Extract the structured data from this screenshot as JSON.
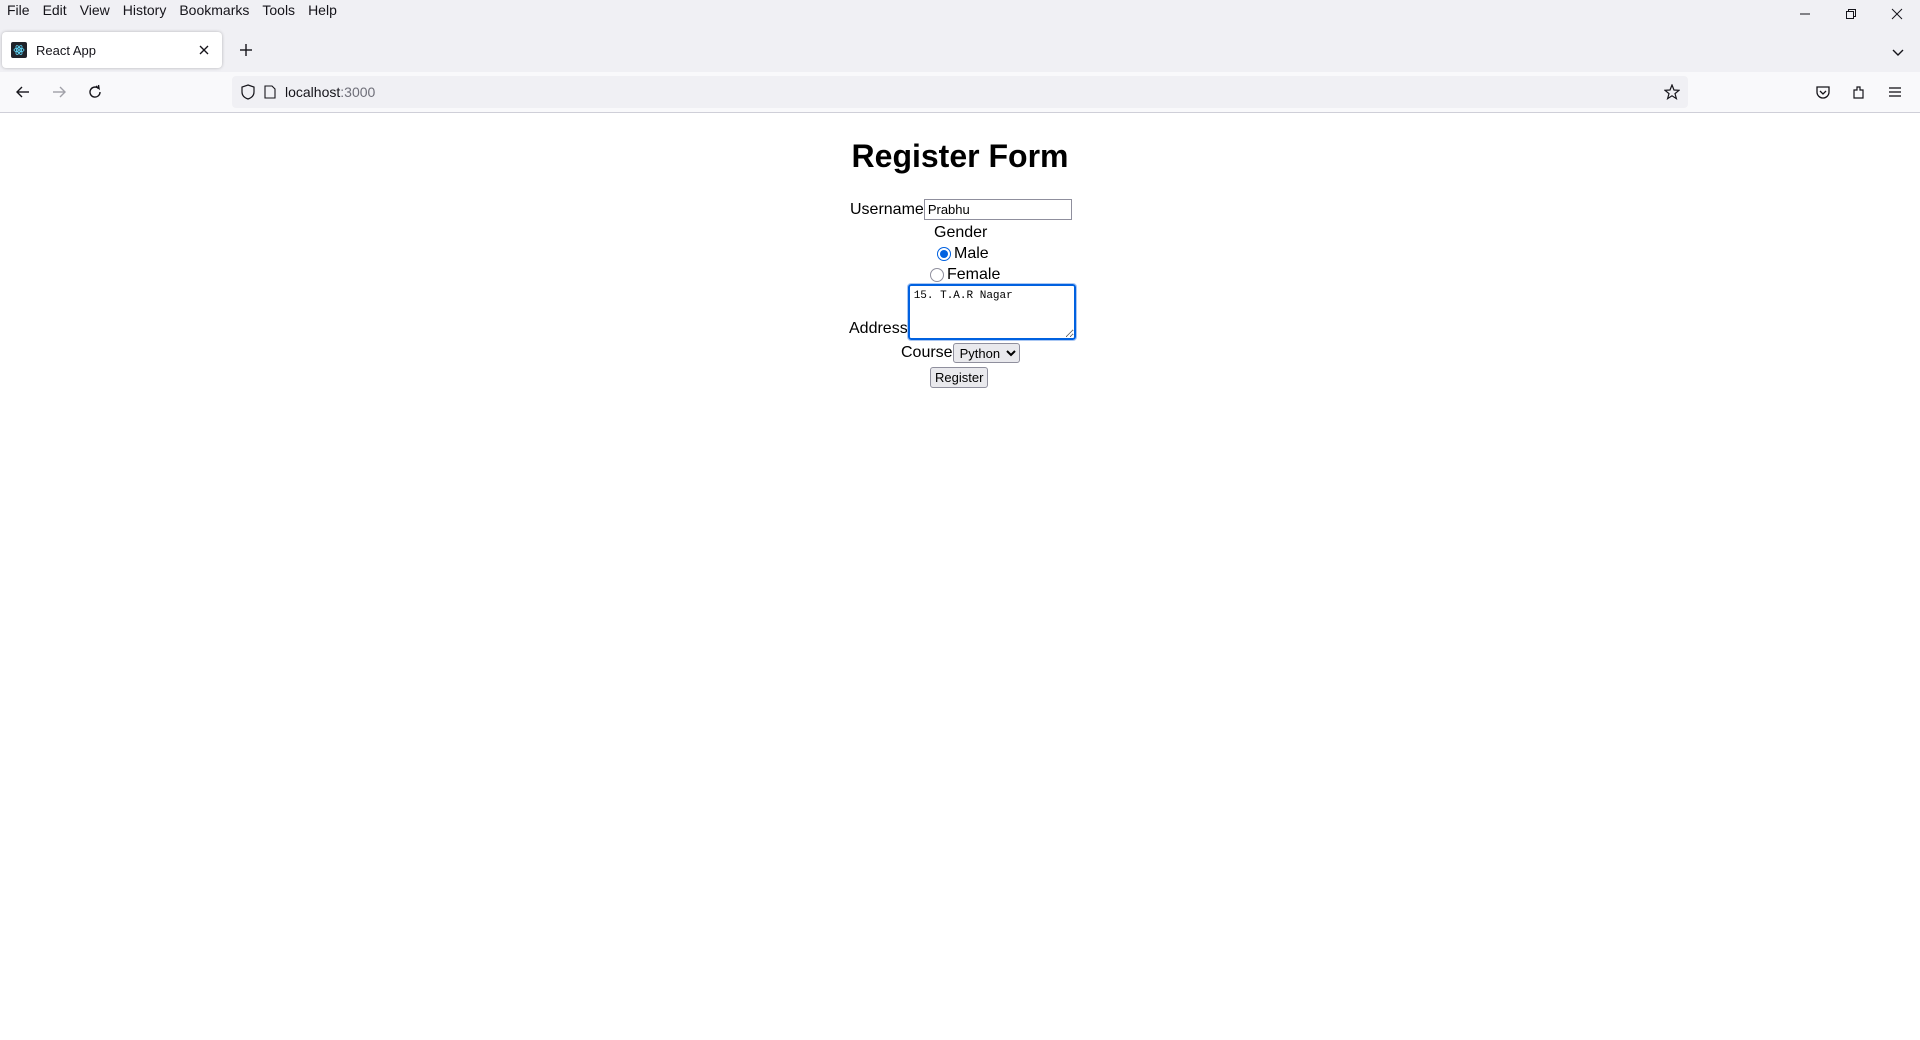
{
  "menu": [
    "File",
    "Edit",
    "View",
    "History",
    "Bookmarks",
    "Tools",
    "Help"
  ],
  "tab": {
    "title": "React App"
  },
  "url": {
    "host": "localhost",
    "port": ":3000"
  },
  "form": {
    "title": "Register Form",
    "username_label": "Username",
    "username_value": "Prabhu",
    "gender_label": "Gender",
    "gender_options": [
      "Male",
      "Female"
    ],
    "gender_selected": "Male",
    "address_label": "Address",
    "address_value": "15. T.A.R Nagar",
    "course_label": "Course",
    "course_selected": "Python",
    "register_label": "Register"
  },
  "colors": {
    "accent": "#0061e0",
    "chrome": "#f0f0f4"
  }
}
